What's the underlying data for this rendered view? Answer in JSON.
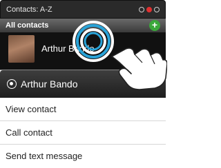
{
  "titlebar": {
    "label": "Contacts: A-Z"
  },
  "header": {
    "label": "All contacts",
    "add_symbol": "+"
  },
  "contact": {
    "name": "Arthur Bando"
  },
  "menu": {
    "title": "Arthur Bando",
    "items": [
      "View contact",
      "Call contact",
      "Send text message"
    ]
  },
  "colors": {
    "accent_green": "#3aa83a",
    "active_dot": "#e03030",
    "touch_ring": "#29a3d8"
  },
  "icons": [
    "menu-circle-icon",
    "add-icon",
    "hand-pointer-icon",
    "touch-ring-icon"
  ]
}
